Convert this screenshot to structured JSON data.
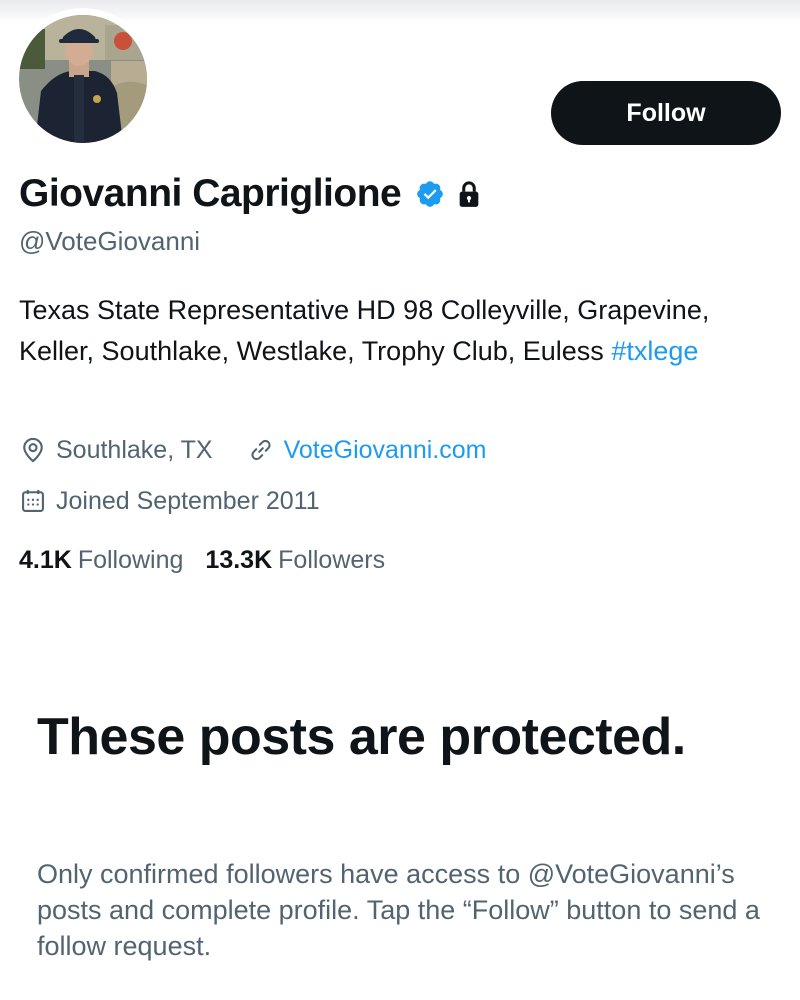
{
  "profile": {
    "name": "Giovanni Capriglione",
    "handle": "@VoteGiovanni",
    "bio_text": "Texas State Representative HD 98 Colleyville, Grapevine, Keller, Southlake, Westlake, Trophy Club, Euless ",
    "bio_hashtag": "#txlege",
    "location": "Southlake, TX",
    "website": "VoteGiovanni.com",
    "joined": "Joined September 2011",
    "following_count": "4.1K",
    "following_label": "Following",
    "followers_count": "13.3K",
    "followers_label": "Followers"
  },
  "actions": {
    "follow_label": "Follow"
  },
  "protected": {
    "title": "These posts are protected.",
    "description": "Only confirmed followers have access to @VoteGiovanni’s posts and complete profile. Tap the “Follow” button to send a follow request."
  },
  "icons": {
    "verified": "verified-badge-icon",
    "protected": "lock-icon",
    "location": "location-pin-icon",
    "website": "link-icon",
    "joined": "calendar-icon"
  },
  "colors": {
    "accent": "#1d9bf0",
    "text_primary": "#0f1419",
    "text_secondary": "#536471",
    "button_bg": "#0f1419"
  }
}
